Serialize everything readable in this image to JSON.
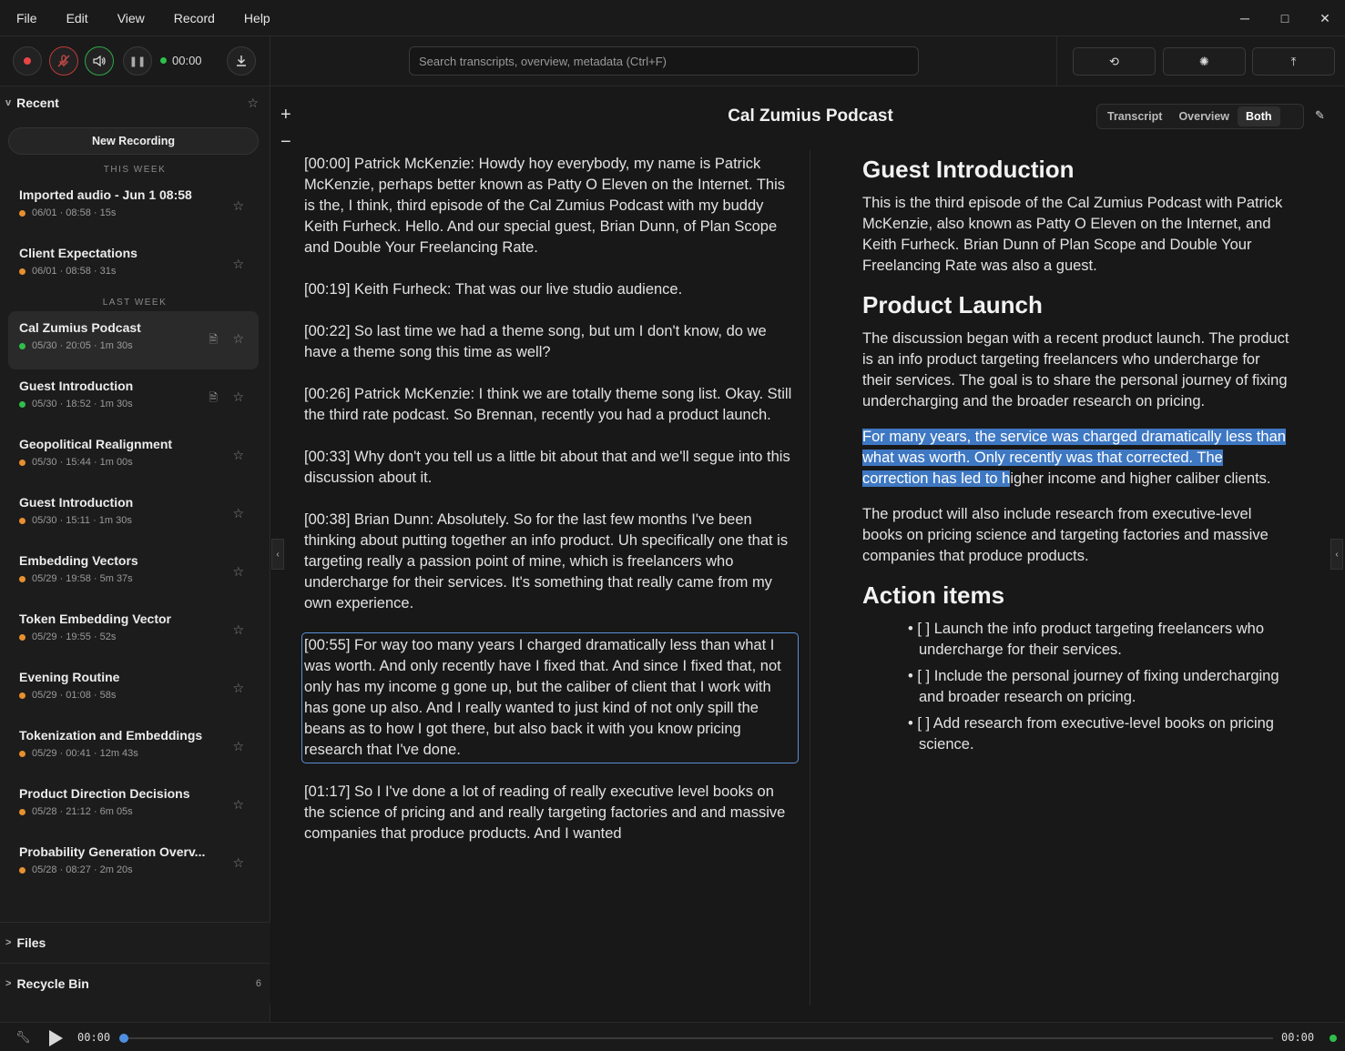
{
  "menu": [
    "File",
    "Edit",
    "View",
    "Record",
    "Help"
  ],
  "toolbar": {
    "timer": "00:00",
    "search_placeholder": "Search transcripts, overview, metadata  (Ctrl+F)"
  },
  "sidebar": {
    "recent_label": "Recent",
    "new_recording": "New Recording",
    "this_week_label": "THIS WEEK",
    "last_week_label": "LAST WEEK",
    "items": [
      {
        "title": "Imported audio - Jun 1 08:58",
        "meta": "06/01 · 08:58 · 15s",
        "status_color": "#e8902e"
      },
      {
        "title": "Client Expectations",
        "meta": "06/01 · 08:58 · 31s",
        "status_color": "#e8902e"
      },
      {
        "title": "Cal Zumius Podcast",
        "meta": "05/30 · 20:05 · 1m 30s",
        "status_color": "#2fbf4a"
      },
      {
        "title": "Guest Introduction",
        "meta": "05/30 · 18:52 · 1m 30s",
        "status_color": "#2fbf4a"
      },
      {
        "title": "Geopolitical Realignment",
        "meta": "05/30 · 15:44 · 1m 00s",
        "status_color": "#e8902e"
      },
      {
        "title": "Guest Introduction",
        "meta": "05/30 · 15:11 · 1m 30s",
        "status_color": "#e8902e"
      },
      {
        "title": "Embedding Vectors",
        "meta": "05/29 · 19:58 · 5m 37s",
        "status_color": "#e8902e"
      },
      {
        "title": "Token Embedding Vector",
        "meta": "05/29 · 19:55 · 52s",
        "status_color": "#e8902e"
      },
      {
        "title": "Evening Routine",
        "meta": "05/29 · 01:08 · 58s",
        "status_color": "#e8902e"
      },
      {
        "title": "Tokenization and Embeddings",
        "meta": "05/29 · 00:41 · 12m 43s",
        "status_color": "#e8902e"
      },
      {
        "title": "Product Direction Decisions",
        "meta": "05/28 · 21:12 · 6m 05s",
        "status_color": "#e8902e"
      },
      {
        "title": "Probability Generation Overv...",
        "meta": "05/28 · 08:27 · 2m 20s",
        "status_color": "#e8902e"
      }
    ],
    "files_label": "Files",
    "recycle_label": "Recycle Bin",
    "recycle_count": "6"
  },
  "document": {
    "title": "Cal Zumius Podcast",
    "tabs": [
      "Transcript",
      "Overview",
      "Both"
    ],
    "active_tab": "Both"
  },
  "transcript": [
    "[00:00] Patrick McKenzie: Howdy hoy everybody, my name is Patrick McKenzie, perhaps better known as Patty O Eleven on the Internet. This is the, I think, third episode of the Cal Zumius Podcast with my buddy Keith Furheck. Hello. And our special guest, Brian Dunn, of Plan Scope and Double Your Freelancing Rate.",
    "[00:19] Keith Furheck: That was our live studio audience.",
    "[00:22] So last time we had a theme song, but um I don't know, do we have a theme song this time as well?",
    "[00:26] Patrick McKenzie: I think we are totally theme song list. Okay. Still the third rate podcast. So Brennan, recently you had a product launch.",
    "[00:33] Why don't you tell us a little bit about that and we'll segue into this discussion about it.",
    "[00:38] Brian Dunn: Absolutely. So for the last few months I've been thinking about putting together an info product. Uh specifically one that is targeting really a passion point of mine, which is freelancers who undercharge for their services. It's something that really came from my own experience.",
    "[00:55] For way too many years I charged dramatically less than what I was worth. And only recently have I fixed that. And since I fixed that, not only has my income g gone up, but the caliber of client that I work with has gone up also. And I really wanted to just kind of not only spill the beans as to how I got there, but also back it with you know pricing research that I've done.",
    "[01:17] So I I've done a lot of reading of really executive level books on the science of pricing and and really targeting factories and and massive companies that produce products. And I wanted"
  ],
  "overview": {
    "h1": "Guest Introduction",
    "p1": "This is the third episode of the Cal Zumius Podcast with Patrick McKenzie, also known as Patty O Eleven on the Internet, and Keith Furheck. Brian Dunn of Plan Scope and Double Your Freelancing Rate was also a guest.",
    "h2": "Product Launch",
    "p2": "The discussion began with a recent product launch. The product is an info product targeting freelancers who undercharge for their services. The goal is to share the personal journey of fixing undercharging and the broader research on pricing.",
    "p3_selected": "For many years, the service was charged dramatically less than what was worth. Only recently was that corrected. The correction has led to h",
    "p3_rest": "igher income and higher caliber clients.",
    "p4": "The product will also include research from executive-level books on pricing science and targeting factories and massive companies that produce products.",
    "h3": "Action items",
    "actions": [
      "• [ ] Launch the info product targeting freelancers who undercharge for their services.",
      "• [ ] Include the personal journey of fixing undercharging and broader research on pricing.",
      "• [ ] Add research from executive-level books on pricing science."
    ]
  },
  "player": {
    "current": "00:00",
    "total": "00:00",
    "progress": 0
  }
}
